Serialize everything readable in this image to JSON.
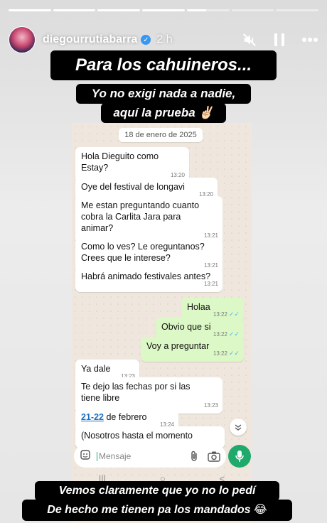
{
  "story": {
    "progress": [
      1,
      1,
      1,
      1,
      0.45,
      0,
      0
    ],
    "username": "diegourrutiabarra",
    "time_ago": "2 h",
    "icons": [
      "mute-icon",
      "pause-icon",
      "more-icon"
    ]
  },
  "captions": {
    "top": "Para los cahuineros...",
    "middle_line1": "Yo no exigi nada a nadie,",
    "middle_line2": "aquí la prueba ✌🏻",
    "bottom_line1": "Vemos claramente que yo no lo pedí",
    "bottom_line2": "De hecho me tienen pa los mandados 😂"
  },
  "chat": {
    "date": "18 de enero de 2025",
    "messages": [
      {
        "text_line1": "Hola Dieguito como",
        "text_line2": "Estay?",
        "time": "13:20"
      },
      {
        "text": "Oye del festival de longavi",
        "time": "13:20"
      },
      {
        "text_line1": "Me estan preguntando cuanto",
        "text_line2": "cobra la Carlita Jara para",
        "text_line3": "animar?",
        "time": "13:21"
      },
      {
        "text_line1": "Como lo ves? Le oreguntanos?",
        "text_line2": "Crees que le interese?",
        "time": "13:21"
      },
      {
        "text": "Habrá animado festivales antes?",
        "time": "13:21"
      },
      {
        "text": "Holaa",
        "time": "13:22"
      },
      {
        "text": "Obvio que si",
        "time": "13:22"
      },
      {
        "text": "Voy a preguntar",
        "time": "13:22"
      },
      {
        "text": "Ya dale",
        "time": "13:23"
      },
      {
        "text_line1": "Te dejo las fechas por si las",
        "text_line2": "tiene libre",
        "time": "13:23"
      },
      {
        "link": "21-22",
        "text": " de febrero",
        "time": "13:24"
      },
      {
        "text": "(Nosotros hasta el momento"
      }
    ],
    "input_placeholder": "Mensaje",
    "nav": [
      "|||",
      "○",
      "<"
    ]
  },
  "colors": {
    "chat_bg": "#efe7dd",
    "outgoing_bubble": "#dcf8c6",
    "send_green": "#1faa6b",
    "read_ticks": "#4fb6ec"
  }
}
